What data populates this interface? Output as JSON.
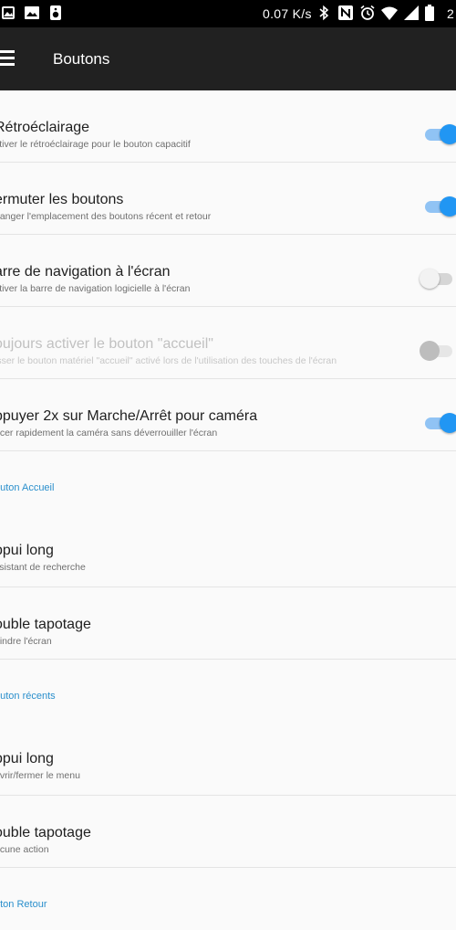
{
  "statusbar": {
    "speed": "0.07 K/s",
    "clock": "2",
    "left_icons": [
      "image-icon",
      "photo-icon",
      "speaker-icon"
    ],
    "right_icons": [
      "bluetooth-icon",
      "nfc-icon",
      "alarm-icon",
      "wifi-icon",
      "signal-icon",
      "battery-icon"
    ]
  },
  "appbar": {
    "title": "Boutons"
  },
  "rows_top": [
    {
      "title": "Rétroéclairage",
      "subtitle": "ctiver le rétroéclairage pour le bouton capacitif",
      "state": "on"
    },
    {
      "title": "ermuter les boutons",
      "subtitle": "hanger l'emplacement des boutons récent et retour",
      "state": "on"
    },
    {
      "title": "arre de navigation à l'écran",
      "subtitle": "ctiver la barre de navigation logicielle à l'écran",
      "state": "off"
    },
    {
      "title": "oujours activer le bouton \"accueil\"",
      "subtitle": "isser le bouton matériel \"accueil\" activé lors de l'utilisation des touches de l'écran",
      "state": "disabled"
    },
    {
      "title": "ppuyer 2x sur Marche/Arrêt pour caméra",
      "subtitle": "ncer rapidement la caméra sans déverrouiller l'écran",
      "state": "on"
    }
  ],
  "section_home": {
    "header": "outon Accueil",
    "rows": [
      {
        "title": "ppui long",
        "subtitle": "ssistant de recherche"
      },
      {
        "title": "ouble tapotage",
        "subtitle": "eindre l'écran"
      }
    ]
  },
  "section_recents": {
    "header": "outon récents",
    "rows": [
      {
        "title": "ppui long",
        "subtitle": "uvrir/fermer le menu"
      },
      {
        "title": "ouble tapotage",
        "subtitle": "ucune action"
      }
    ]
  },
  "section_back": {
    "header": "uton Retour"
  },
  "colors": {
    "accent": "#2196f3",
    "appbar": "#212121",
    "section_header": "#2a8fcc"
  }
}
